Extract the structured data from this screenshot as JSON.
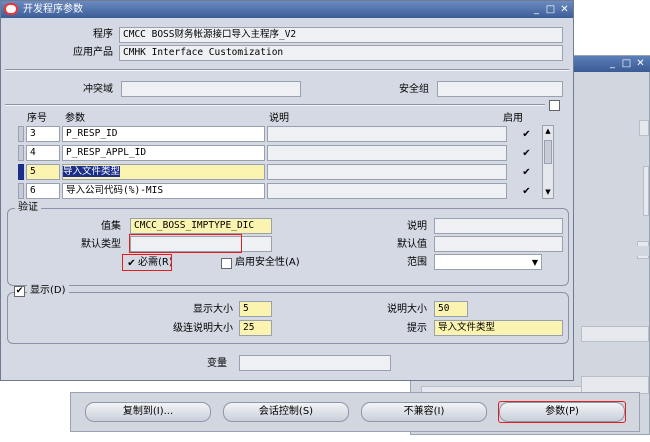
{
  "window_title": "开发程序参数",
  "header": {
    "program_label": "程序",
    "program_value": "CMCC BOSS财务帐源接口导入主程序_V2",
    "app_label": "应用产品",
    "app_value": "CMHK Interface Customization",
    "conflict_label": "冲突域",
    "security_label": "安全组"
  },
  "grid": {
    "col_seq": "序号",
    "col_param": "参数",
    "col_desc": "说明",
    "col_enabled": "启用",
    "rows": [
      {
        "seq": "3",
        "param": "P_RESP_ID",
        "enabled": "✔"
      },
      {
        "seq": "4",
        "param": "P_RESP_APPL_ID",
        "enabled": "✔"
      },
      {
        "seq": "5",
        "param": "导入文件类型",
        "enabled": "✔"
      },
      {
        "seq": "6",
        "param": "导入公司代码(%)-MIS",
        "enabled": "✔"
      }
    ]
  },
  "validation": {
    "group_label": "验证",
    "valueset_label": "值集",
    "valueset_value": "CMCC_BOSS_IMPTYPE_DIC",
    "default_type_label": "默认类型",
    "required_label": "必需(R)",
    "required_checked": "✔",
    "enable_security_label": "启用安全性(A)",
    "desc_label": "说明",
    "default_value_label": "默认值",
    "range_label": "范围"
  },
  "display": {
    "group_label": "显示(D)",
    "display_checked": "✔",
    "display_size_label": "显示大小",
    "display_size_value": "5",
    "desc_size_label": "说明大小",
    "desc_size_value": "50",
    "concat_desc_size_label": "级连说明大小",
    "concat_desc_size_value": "25",
    "prompt_label": "提示",
    "prompt_value": "导入文件类型"
  },
  "token": {
    "label": "变量"
  },
  "buttons": {
    "copy": "复制到(I)...",
    "session": "会话控制(S)",
    "incompat": "不兼容(I)",
    "params": "参数(P)"
  },
  "colors": {
    "highlight": "#1a2e8a",
    "required_field": "#fbf4b0",
    "annotation_red": "#e02020"
  }
}
